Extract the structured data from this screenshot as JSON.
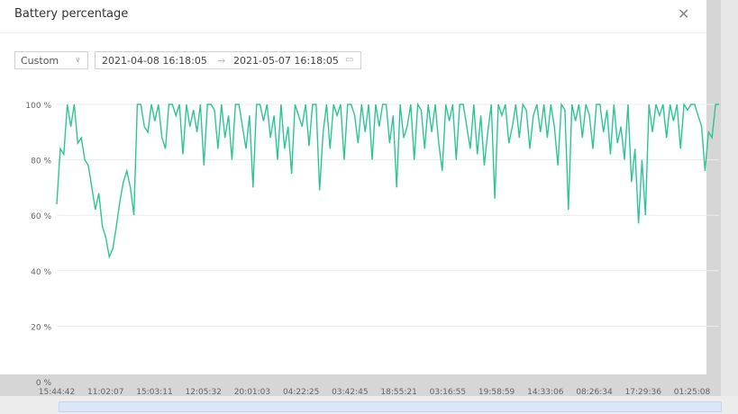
{
  "dialog": {
    "title": "Battery percentage",
    "close_icon": "close-icon"
  },
  "filters": {
    "preset": "Custom",
    "start": "2021-04-08 16:18:05",
    "separator": "→",
    "end": "2021-05-07 16:18:05",
    "calendar_icon": "calendar-icon"
  },
  "chart_data": {
    "type": "line",
    "title": "",
    "xlabel": "",
    "ylabel": "",
    "ylim": [
      0,
      100
    ],
    "yticks": [
      "0 %",
      "20 %",
      "40 %",
      "60 %",
      "80 %",
      "100 %"
    ],
    "ytick_values": [
      0,
      20,
      40,
      60,
      80,
      100
    ],
    "xticks": [
      "15:44:42",
      "11:02:07",
      "15:03:11",
      "12:05:32",
      "20:01:03",
      "04:22:25",
      "03:42:45",
      "18:55:21",
      "03:16:55",
      "19:58:59",
      "14:33:06",
      "08:26:34",
      "17:29:36",
      "01:25:08"
    ],
    "grid": true,
    "color": "#2dc595",
    "values": [
      64,
      84,
      82,
      100,
      92,
      100,
      86,
      88,
      80,
      78,
      70,
      62,
      68,
      56,
      52,
      45,
      48,
      56,
      65,
      72,
      76,
      70,
      60,
      100,
      100,
      92,
      90,
      100,
      94,
      100,
      88,
      84,
      100,
      100,
      96,
      100,
      82,
      100,
      92,
      98,
      90,
      100,
      78,
      100,
      100,
      98,
      84,
      100,
      88,
      96,
      80,
      100,
      100,
      92,
      84,
      96,
      70,
      100,
      100,
      94,
      100,
      88,
      96,
      80,
      100,
      84,
      92,
      75,
      100,
      96,
      92,
      100,
      85,
      100,
      100,
      69,
      90,
      100,
      84,
      100,
      96,
      100,
      80,
      100,
      100,
      96,
      86,
      100,
      90,
      100,
      80,
      100,
      92,
      100,
      100,
      86,
      96,
      70,
      100,
      88,
      92,
      100,
      80,
      100,
      98,
      84,
      100,
      90,
      100,
      86,
      76,
      100,
      94,
      100,
      80,
      100,
      100,
      92,
      84,
      100,
      82,
      96,
      78,
      90,
      100,
      66,
      100,
      96,
      100,
      86,
      92,
      100,
      88,
      100,
      98,
      84,
      96,
      100,
      90,
      100,
      88,
      100,
      92,
      78,
      100,
      98,
      62,
      100,
      94,
      100,
      88,
      100,
      96,
      84,
      100,
      100,
      90,
      98,
      82,
      100,
      86,
      92,
      80,
      100,
      72,
      84,
      57,
      80,
      60,
      100,
      90,
      100,
      96,
      100,
      88,
      100,
      94,
      100,
      84,
      100,
      98,
      100,
      100,
      96,
      92,
      76,
      90,
      88,
      100,
      100
    ]
  }
}
